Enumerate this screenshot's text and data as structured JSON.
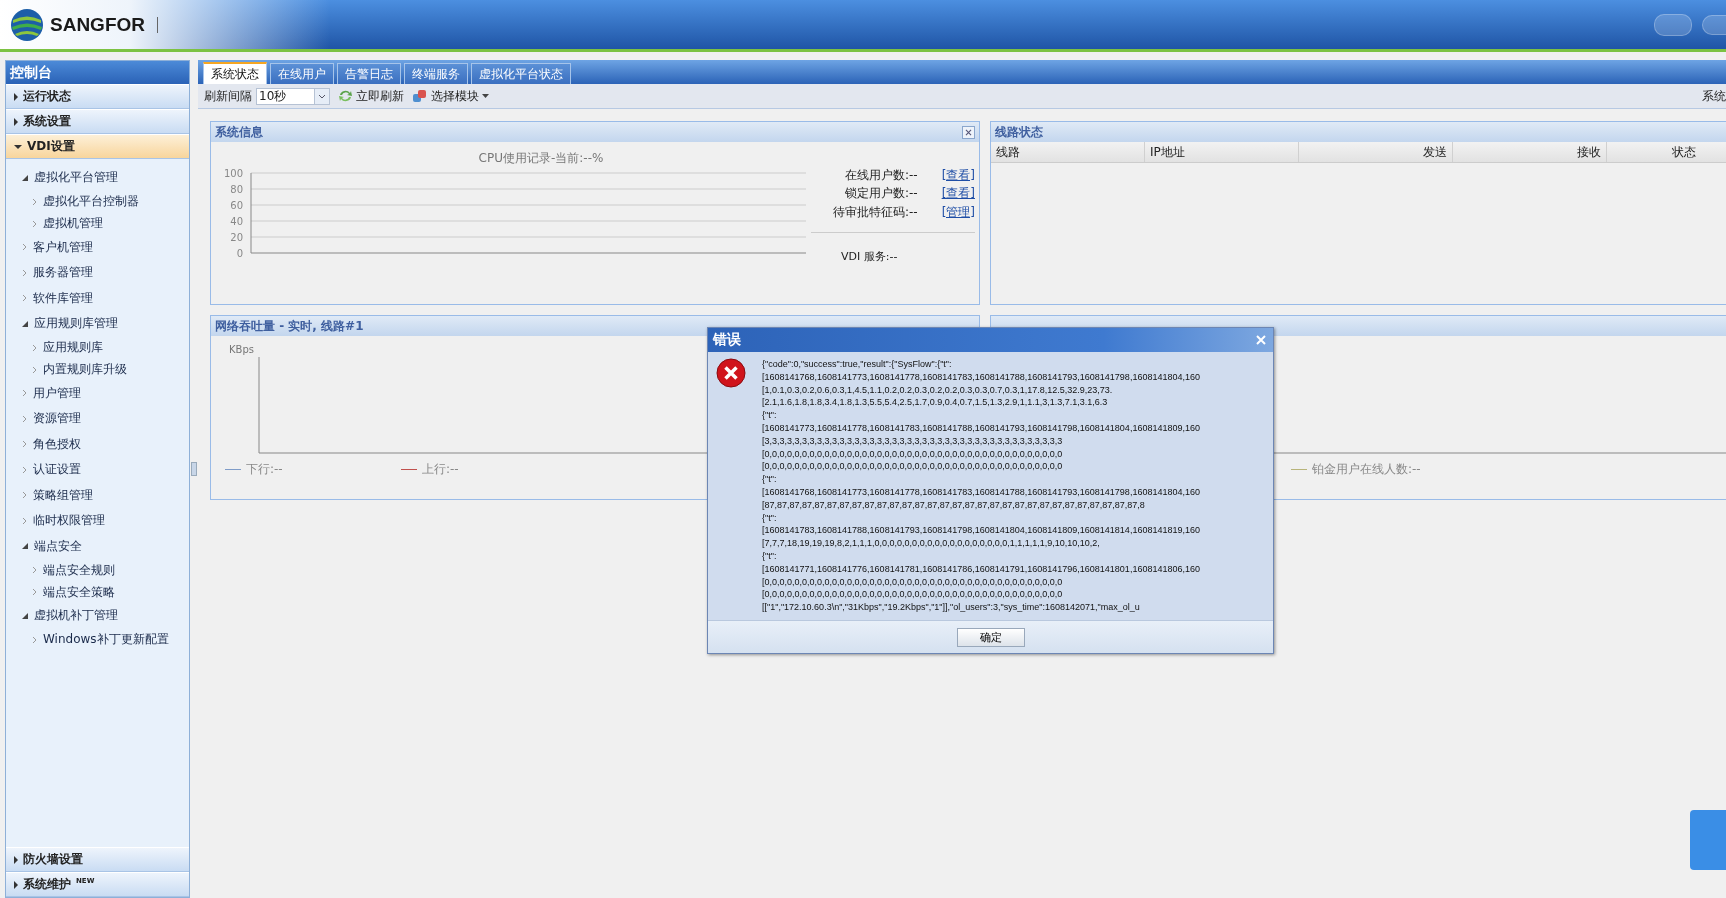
{
  "header": {
    "logo": "SANGFOR"
  },
  "sidebar": {
    "title": "控制台",
    "sections": [
      {
        "label": "运行状态",
        "expanded": false
      },
      {
        "label": "系统设置",
        "expanded": false
      },
      {
        "label": "VDI设置",
        "expanded": true,
        "children": [
          {
            "label": "虚拟化平台管理",
            "expanded": true,
            "children": [
              {
                "label": "虚拟化平台控制器",
                "expanded": false
              },
              {
                "label": "虚拟机管理",
                "expanded": false
              }
            ]
          },
          {
            "label": "客户机管理",
            "expanded": false
          },
          {
            "label": "服务器管理",
            "expanded": false
          },
          {
            "label": "软件库管理",
            "expanded": false
          },
          {
            "label": "应用规则库管理",
            "expanded": true,
            "children": [
              {
                "label": "应用规则库",
                "expanded": false
              },
              {
                "label": "内置规则库升级",
                "expanded": false
              }
            ]
          },
          {
            "label": "用户管理",
            "expanded": false
          },
          {
            "label": "资源管理",
            "expanded": false
          },
          {
            "label": "角色授权",
            "expanded": false
          },
          {
            "label": "认证设置",
            "expanded": false
          },
          {
            "label": "策略组管理",
            "expanded": false
          },
          {
            "label": "临时权限管理",
            "expanded": false
          },
          {
            "label": "端点安全",
            "expanded": true,
            "children": [
              {
                "label": "端点安全规则",
                "expanded": false
              },
              {
                "label": "端点安全策略",
                "expanded": false
              }
            ]
          },
          {
            "label": "虚拟机补丁管理",
            "expanded": true,
            "children": [
              {
                "label": "Windows补丁更新配置",
                "expanded": false
              }
            ]
          }
        ]
      },
      {
        "label": "防火墙设置",
        "expanded": false
      },
      {
        "label": "系统维护",
        "expanded": false,
        "badge": "NEW"
      }
    ]
  },
  "tabs": [
    {
      "label": "系统状态",
      "selected": true
    },
    {
      "label": "在线用户",
      "selected": false
    },
    {
      "label": "告警日志",
      "selected": false
    },
    {
      "label": "终端服务",
      "selected": false
    },
    {
      "label": "虚拟化平台状态",
      "selected": false
    }
  ],
  "toolbar": {
    "interval_label": "刷新间隔",
    "interval_value": "10秒",
    "refresh": "立即刷新",
    "select_module": "选择模块",
    "right_text": "系统"
  },
  "system_info": {
    "title": "系统信息",
    "cpu_title": "CPU使用记录-当前:--%",
    "y_ticks": [
      "100",
      "80",
      "60",
      "40",
      "20",
      "0"
    ],
    "stats": [
      {
        "label": "在线用户数:--",
        "link": "[查看]"
      },
      {
        "label": "锁定用户数:--",
        "link": "[查看]"
      },
      {
        "label": "待审批特征码:--",
        "link": "[管理]"
      }
    ],
    "vdi_service": "VDI 服务:--"
  },
  "line_status": {
    "title": "线路状态",
    "columns": [
      "线路",
      "IP地址",
      "发送",
      "接收",
      "状态"
    ]
  },
  "throughput": {
    "title": "网络吞吐量 - 实时, 线路#1",
    "unit": "KBps",
    "legend": [
      {
        "label": "下行:--",
        "color": "#7f9cc8"
      },
      {
        "label": "上行:--",
        "color": "#c0504d"
      }
    ]
  },
  "concurrent": {
    "legend": [
      {
        "label": "铂金用户在线人数:--",
        "color": "#b8b47a"
      }
    ]
  },
  "dialog": {
    "title": "错误",
    "lines": [
      "{\"code\":0,\"success\":true,\"result\":{\"SysFlow\":{\"t\":",
      "[1608141768,1608141773,1608141778,1608141783,1608141788,1608141793,1608141798,1608141804,160",
      "[1,0.1,0.3,0.2,0.6,0.3,1,4.5,1.1,0.2,0.2,0.3,0.2,0.2,0.3,0.3,0.7,0.3,1,17.8,12.5,32.9,23,73.",
      "[2.1,1.6,1.8,1.8,3.4,1.8,1.3,5.5,5.4,2.5,1.7,0.9,0.4,0.7,1.5,1.3,2.9,1,1.1,3,1.3,7.1,3.1,6.3",
      "{\"t\":",
      "[1608141773,1608141778,1608141783,1608141788,1608141793,1608141798,1608141804,1608141809,160",
      "[3,3,3,3,3,3,3,3,3,3,3,3,3,3,3,3,3,3,3,3,3,3,3,3,3,3,3,3,3,3,3,3,3,3,3,3,3,3,3,3",
      "[0,0,0,0,0,0,0,0,0,0,0,0,0,0,0,0,0,0,0,0,0,0,0,0,0,0,0,0,0,0,0,0,0,0,0,0,0,0,0,0",
      "[0,0,0,0,0,0,0,0,0,0,0,0,0,0,0,0,0,0,0,0,0,0,0,0,0,0,0,0,0,0,0,0,0,0,0,0,0,0,0,0",
      "{\"t\":",
      "[1608141768,1608141773,1608141778,1608141783,1608141788,1608141793,1608141798,1608141804,160",
      "[87,87,87,87,87,87,87,87,87,87,87,87,87,87,87,87,87,87,87,87,87,87,87,87,87,87,87,87,87,87,8",
      "{\"t\":",
      "[1608141783,1608141788,1608141793,1608141798,1608141804,1608141809,1608141814,1608141819,160",
      "[7,7,7,18,19,19,19,8,2,1,1,1,0,0,0,0,0,0,0,0,0,0,0,0,0,0,0,0,0,0,1,1,1,1,1,9,10,10,10,2,",
      "{\"t\":",
      "[1608141771,1608141776,1608141781,1608141786,1608141791,1608141796,1608141801,1608141806,160",
      "[0,0,0,0,0,0,0,0,0,0,0,0,0,0,0,0,0,0,0,0,0,0,0,0,0,0,0,0,0,0,0,0,0,0,0,0,0,0,0,0",
      "[0,0,0,0,0,0,0,0,0,0,0,0,0,0,0,0,0,0,0,0,0,0,0,0,0,0,0,0,0,0,0,0,0,0,0,0,0,0,0,0",
      "[[\"1\",\"172.10.60.3\\n\",\"31Kbps\",\"19.2Kbps\",\"1\"]],\"ol_users\":3,\"sys_time\":1608142071,\"max_ol_u"
    ],
    "button": "确定"
  }
}
